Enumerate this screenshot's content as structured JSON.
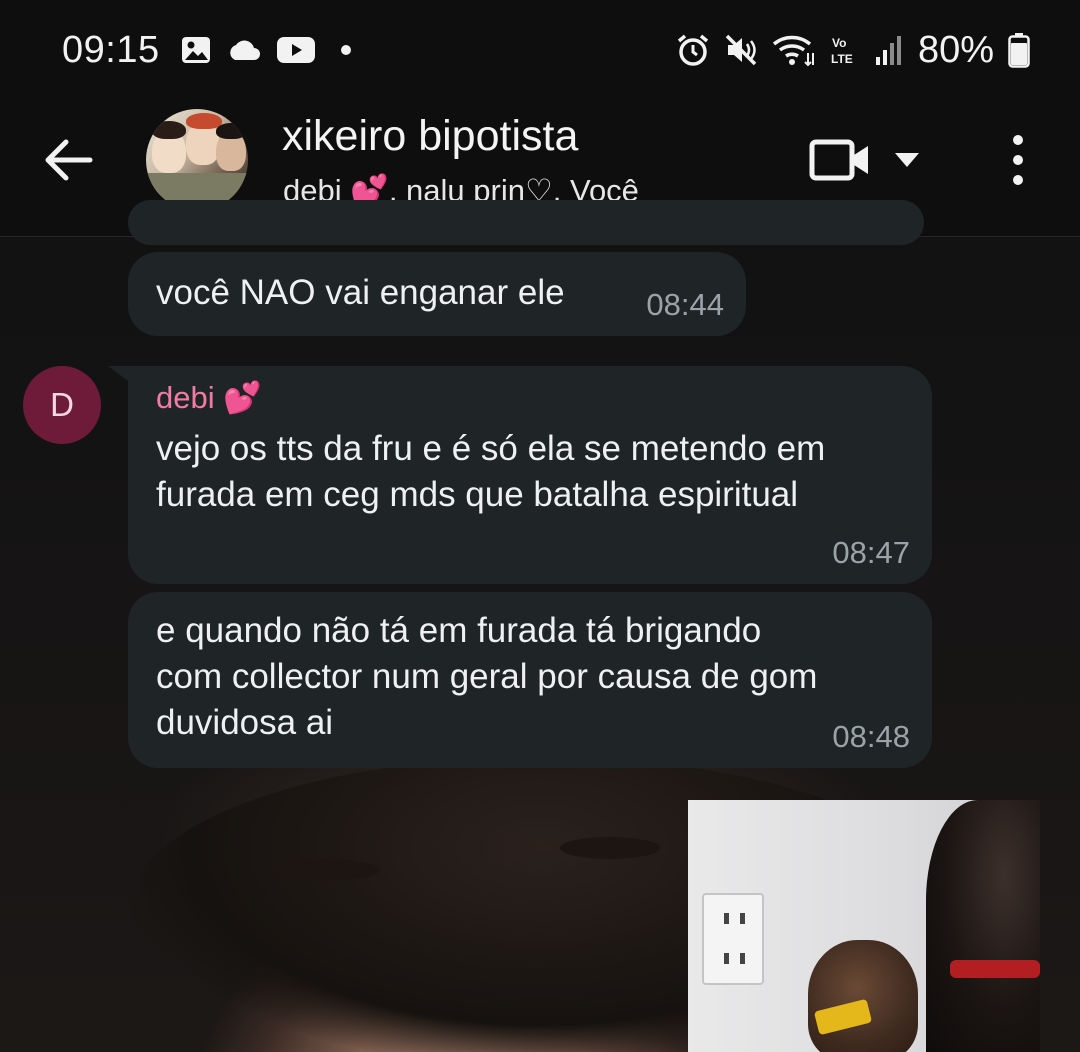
{
  "status_bar": {
    "time": "09:15",
    "battery": "80%",
    "icons_left": [
      "gallery-icon",
      "cloud-icon",
      "youtube-icon",
      "dot-icon"
    ],
    "icons_right": [
      "alarm-icon",
      "mute-icon",
      "wifi-icon",
      "volte-icon",
      "signal-icon",
      "battery-icon"
    ]
  },
  "header": {
    "title": "xikeiro bipotista",
    "subtitle": "debi 💕, nalu prin♡, Você"
  },
  "messages": [
    {
      "text": "você NAO vai enganar ele",
      "time": "08:44"
    },
    {
      "sender": "debi 💕",
      "avatar_letter": "D",
      "text": "vejo os tts da fru e é só ela se metendo em\nfurada em ceg mds que batalha espiritual",
      "time": "08:47"
    },
    {
      "text": "e quando não tá em furada tá brigando\ncom collector num geral por causa de gom\nduvidosa ai",
      "time": "08:48"
    }
  ],
  "colors": {
    "bubble": "#1f2427",
    "sender_name": "#f27ba3",
    "avatar_bg": "#6e1b3a",
    "timestamp": "#9aa3a8"
  }
}
